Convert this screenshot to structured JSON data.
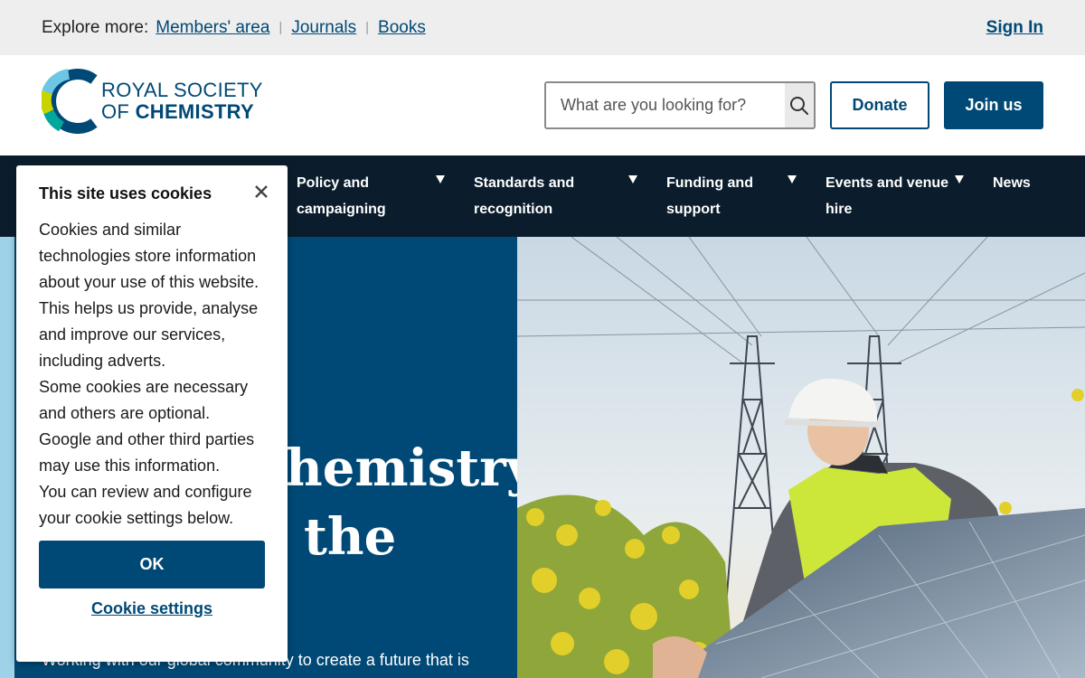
{
  "utility": {
    "explore_label": "Explore more:",
    "links": [
      "Members' area",
      "Journals",
      "Books"
    ],
    "separator": "|",
    "sign_in": "Sign In"
  },
  "header": {
    "logo": {
      "line1": "ROYAL SOCIETY",
      "line2_prefix": "OF ",
      "line2_bold": "CHEMISTRY",
      "icon": "rsc-logo-icon"
    },
    "search": {
      "placeholder": "What are you looking for?",
      "icon": "search-icon"
    },
    "donate_label": "Donate",
    "join_label": "Join us"
  },
  "nav": {
    "items": [
      {
        "label_line1": "Policy and",
        "label_line2": "campaigning"
      },
      {
        "label_line1": "Standards and",
        "label_line2": "recognition"
      },
      {
        "label_line1": "Funding and",
        "label_line2": "support"
      },
      {
        "label_line1": "Events and venue",
        "label_line2": "hire"
      },
      {
        "label_line1": "News",
        "label_line2": ""
      }
    ],
    "dropdown_icon": "triangle-down-icon"
  },
  "hero": {
    "heading_line1": "hemistry",
    "heading_line2": "the",
    "subtext": "Working with our global community to create a future that is"
  },
  "cookie": {
    "title": "This site uses cookies",
    "close_icon": "close-icon",
    "body": [
      "Cookies and similar technologies store information about your use of this website. This helps us provide, analyse and improve our services, including adverts.",
      "Some cookies are necessary and others are optional. Google and other third parties may use this information.",
      "You can review and configure your cookie settings below."
    ],
    "ok_label": "OK",
    "settings_label": "Cookie settings"
  },
  "colors": {
    "brand": "#004976",
    "nav_bg": "#0b1d2c",
    "utility_bg": "#eeeeee",
    "accent_light_blue": "#9dd2e8"
  }
}
